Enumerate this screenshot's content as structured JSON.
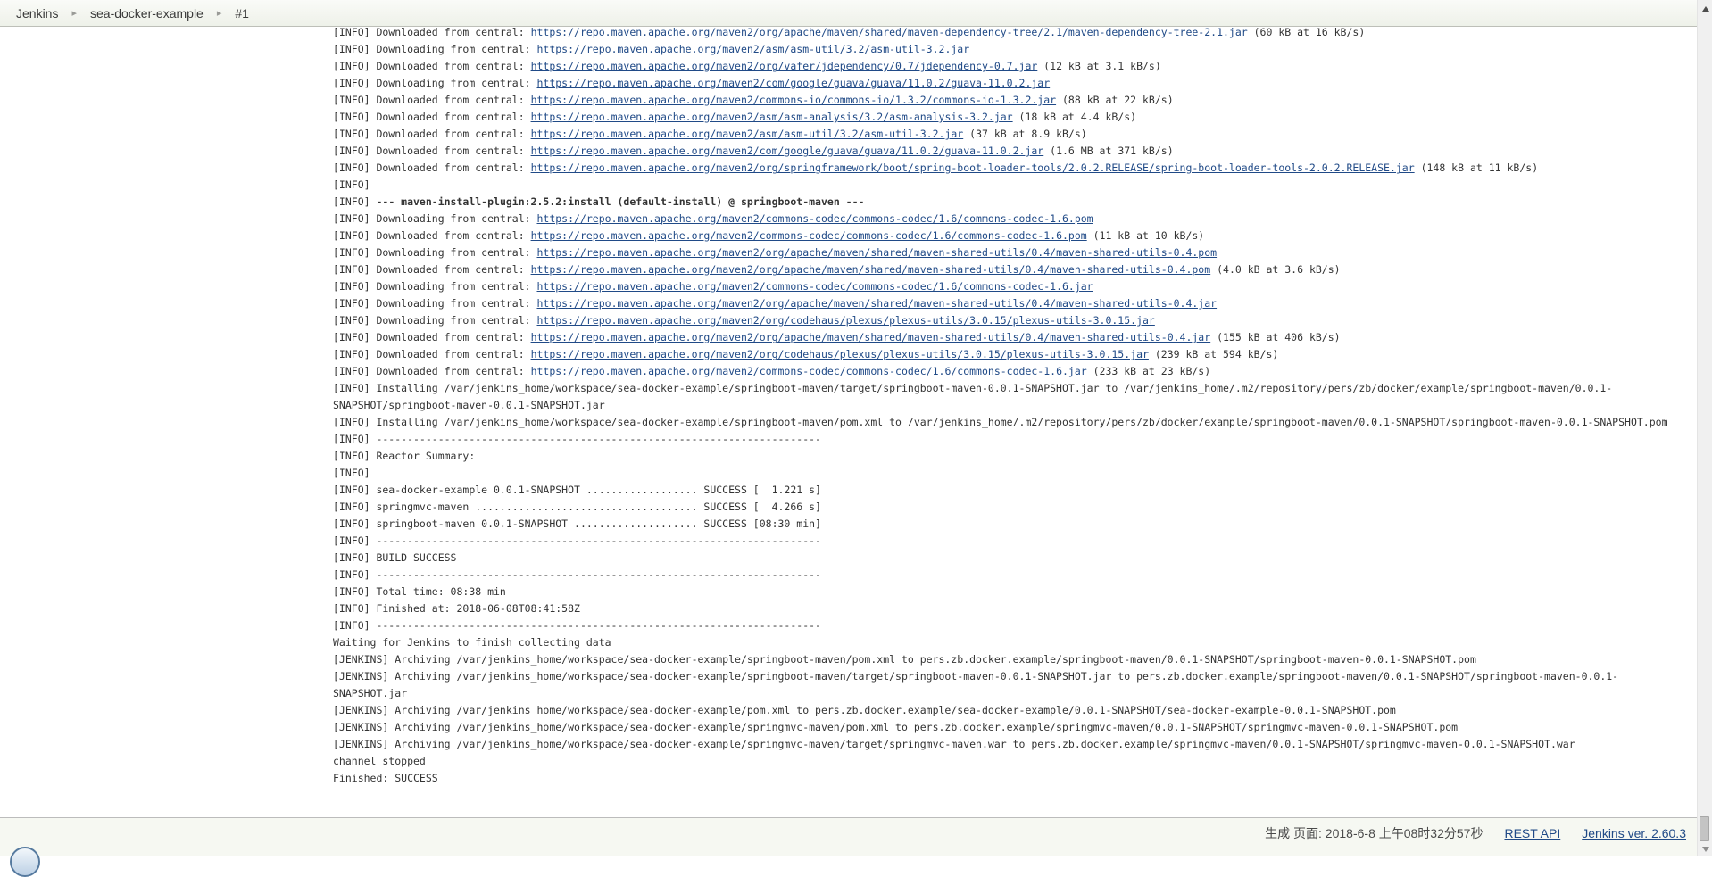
{
  "breadcrumb": {
    "items": [
      "Jenkins",
      "sea-docker-example",
      "#1"
    ]
  },
  "colors": {
    "link": "#204a87",
    "console_text": "#333333",
    "breadcrumb_bg": "#f2f5ec",
    "footer_bg": "#f6f8f2"
  },
  "console": {
    "lines": [
      {
        "pre": "[INFO] Downloaded from central: ",
        "url": "https://repo.maven.apache.org/maven2/org/apache/maven/shared/maven-dependency-tree/2.1/maven-dependency-tree-2.1.jar",
        "suffix": " (60 kB at 16 kB/s)"
      },
      {
        "pre": "[INFO] Downloading from central: ",
        "url": "https://repo.maven.apache.org/maven2/asm/asm-util/3.2/asm-util-3.2.jar"
      },
      {
        "pre": "[INFO] Downloaded from central: ",
        "url": "https://repo.maven.apache.org/maven2/org/vafer/jdependency/0.7/jdependency-0.7.jar",
        "suffix": " (12 kB at 3.1 kB/s)"
      },
      {
        "pre": "[INFO] Downloading from central: ",
        "url": "https://repo.maven.apache.org/maven2/com/google/guava/guava/11.0.2/guava-11.0.2.jar"
      },
      {
        "pre": "[INFO] Downloaded from central: ",
        "url": "https://repo.maven.apache.org/maven2/commons-io/commons-io/1.3.2/commons-io-1.3.2.jar",
        "suffix": " (88 kB at 22 kB/s)"
      },
      {
        "pre": "[INFO] Downloaded from central: ",
        "url": "https://repo.maven.apache.org/maven2/asm/asm-analysis/3.2/asm-analysis-3.2.jar",
        "suffix": " (18 kB at 4.4 kB/s)"
      },
      {
        "pre": "[INFO] Downloaded from central: ",
        "url": "https://repo.maven.apache.org/maven2/asm/asm-util/3.2/asm-util-3.2.jar",
        "suffix": " (37 kB at 8.9 kB/s)"
      },
      {
        "pre": "[INFO] Downloaded from central: ",
        "url": "https://repo.maven.apache.org/maven2/com/google/guava/guava/11.0.2/guava-11.0.2.jar",
        "suffix": " (1.6 MB at 371 kB/s)"
      },
      {
        "pre": "[INFO] Downloaded from central: ",
        "url": "https://repo.maven.apache.org/maven2/org/springframework/boot/spring-boot-loader-tools/2.0.2.RELEASE/spring-boot-loader-tools-2.0.2.RELEASE.jar",
        "suffix": " (148 kB at 11 kB/s)"
      },
      {
        "text": "[INFO]"
      },
      {
        "pre": "[INFO] ",
        "bold": "--- maven-install-plugin:2.5.2:install (default-install) @ springboot-maven ---"
      },
      {
        "pre": "[INFO] Downloading from central: ",
        "url": "https://repo.maven.apache.org/maven2/commons-codec/commons-codec/1.6/commons-codec-1.6.pom"
      },
      {
        "pre": "[INFO] Downloaded from central: ",
        "url": "https://repo.maven.apache.org/maven2/commons-codec/commons-codec/1.6/commons-codec-1.6.pom",
        "suffix": " (11 kB at 10 kB/s)"
      },
      {
        "pre": "[INFO] Downloading from central: ",
        "url": "https://repo.maven.apache.org/maven2/org/apache/maven/shared/maven-shared-utils/0.4/maven-shared-utils-0.4.pom"
      },
      {
        "pre": "[INFO] Downloaded from central: ",
        "url": "https://repo.maven.apache.org/maven2/org/apache/maven/shared/maven-shared-utils/0.4/maven-shared-utils-0.4.pom",
        "suffix": " (4.0 kB at 3.6 kB/s)"
      },
      {
        "pre": "[INFO] Downloading from central: ",
        "url": "https://repo.maven.apache.org/maven2/commons-codec/commons-codec/1.6/commons-codec-1.6.jar"
      },
      {
        "pre": "[INFO] Downloading from central: ",
        "url": "https://repo.maven.apache.org/maven2/org/apache/maven/shared/maven-shared-utils/0.4/maven-shared-utils-0.4.jar"
      },
      {
        "pre": "[INFO] Downloading from central: ",
        "url": "https://repo.maven.apache.org/maven2/org/codehaus/plexus/plexus-utils/3.0.15/plexus-utils-3.0.15.jar"
      },
      {
        "pre": "[INFO] Downloaded from central: ",
        "url": "https://repo.maven.apache.org/maven2/org/apache/maven/shared/maven-shared-utils/0.4/maven-shared-utils-0.4.jar",
        "suffix": " (155 kB at 406 kB/s)"
      },
      {
        "pre": "[INFO] Downloaded from central: ",
        "url": "https://repo.maven.apache.org/maven2/org/codehaus/plexus/plexus-utils/3.0.15/plexus-utils-3.0.15.jar",
        "suffix": " (239 kB at 594 kB/s)"
      },
      {
        "pre": "[INFO] Downloaded from central: ",
        "url": "https://repo.maven.apache.org/maven2/commons-codec/commons-codec/1.6/commons-codec-1.6.jar",
        "suffix": " (233 kB at 23 kB/s)"
      },
      {
        "text": "[INFO] Installing /var/jenkins_home/workspace/sea-docker-example/springboot-maven/target/springboot-maven-0.0.1-SNAPSHOT.jar to /var/jenkins_home/.m2/repository/pers/zb/docker/example/springboot-maven/0.0.1-SNAPSHOT/springboot-maven-0.0.1-SNAPSHOT.jar"
      },
      {
        "text": "[INFO] Installing /var/jenkins_home/workspace/sea-docker-example/springboot-maven/pom.xml to /var/jenkins_home/.m2/repository/pers/zb/docker/example/springboot-maven/0.0.1-SNAPSHOT/springboot-maven-0.0.1-SNAPSHOT.pom"
      },
      {
        "text": "[INFO] ------------------------------------------------------------------------"
      },
      {
        "text": "[INFO] Reactor Summary:"
      },
      {
        "text": "[INFO]"
      },
      {
        "text": "[INFO] sea-docker-example 0.0.1-SNAPSHOT .................. SUCCESS [  1.221 s]"
      },
      {
        "text": "[INFO] springmvc-maven .................................... SUCCESS [  4.266 s]"
      },
      {
        "text": "[INFO] springboot-maven 0.0.1-SNAPSHOT .................... SUCCESS [08:30 min]"
      },
      {
        "text": "[INFO] ------------------------------------------------------------------------"
      },
      {
        "text": "[INFO] BUILD SUCCESS"
      },
      {
        "text": "[INFO] ------------------------------------------------------------------------"
      },
      {
        "text": "[INFO] Total time: 08:38 min"
      },
      {
        "text": "[INFO] Finished at: 2018-06-08T08:41:58Z"
      },
      {
        "text": "[INFO] ------------------------------------------------------------------------"
      },
      {
        "text": "Waiting for Jenkins to finish collecting data"
      },
      {
        "text": "[JENKINS] Archiving /var/jenkins_home/workspace/sea-docker-example/springboot-maven/pom.xml to pers.zb.docker.example/springboot-maven/0.0.1-SNAPSHOT/springboot-maven-0.0.1-SNAPSHOT.pom"
      },
      {
        "text": "[JENKINS] Archiving /var/jenkins_home/workspace/sea-docker-example/springboot-maven/target/springboot-maven-0.0.1-SNAPSHOT.jar to pers.zb.docker.example/springboot-maven/0.0.1-SNAPSHOT/springboot-maven-0.0.1-SNAPSHOT.jar"
      },
      {
        "text": "[JENKINS] Archiving /var/jenkins_home/workspace/sea-docker-example/pom.xml to pers.zb.docker.example/sea-docker-example/0.0.1-SNAPSHOT/sea-docker-example-0.0.1-SNAPSHOT.pom"
      },
      {
        "text": "[JENKINS] Archiving /var/jenkins_home/workspace/sea-docker-example/springmvc-maven/pom.xml to pers.zb.docker.example/springmvc-maven/0.0.1-SNAPSHOT/springmvc-maven-0.0.1-SNAPSHOT.pom"
      },
      {
        "text": "[JENKINS] Archiving /var/jenkins_home/workspace/sea-docker-example/springmvc-maven/target/springmvc-maven.war to pers.zb.docker.example/springmvc-maven/0.0.1-SNAPSHOT/springmvc-maven-0.0.1-SNAPSHOT.war"
      },
      {
        "text": "channel stopped"
      },
      {
        "text": "Finished: SUCCESS"
      }
    ]
  },
  "footer": {
    "generated": "生成 页面: 2018-6-8 上午08时32分57秒",
    "rest_api_label": "REST API",
    "version_label": "Jenkins ver. 2.60.3"
  }
}
